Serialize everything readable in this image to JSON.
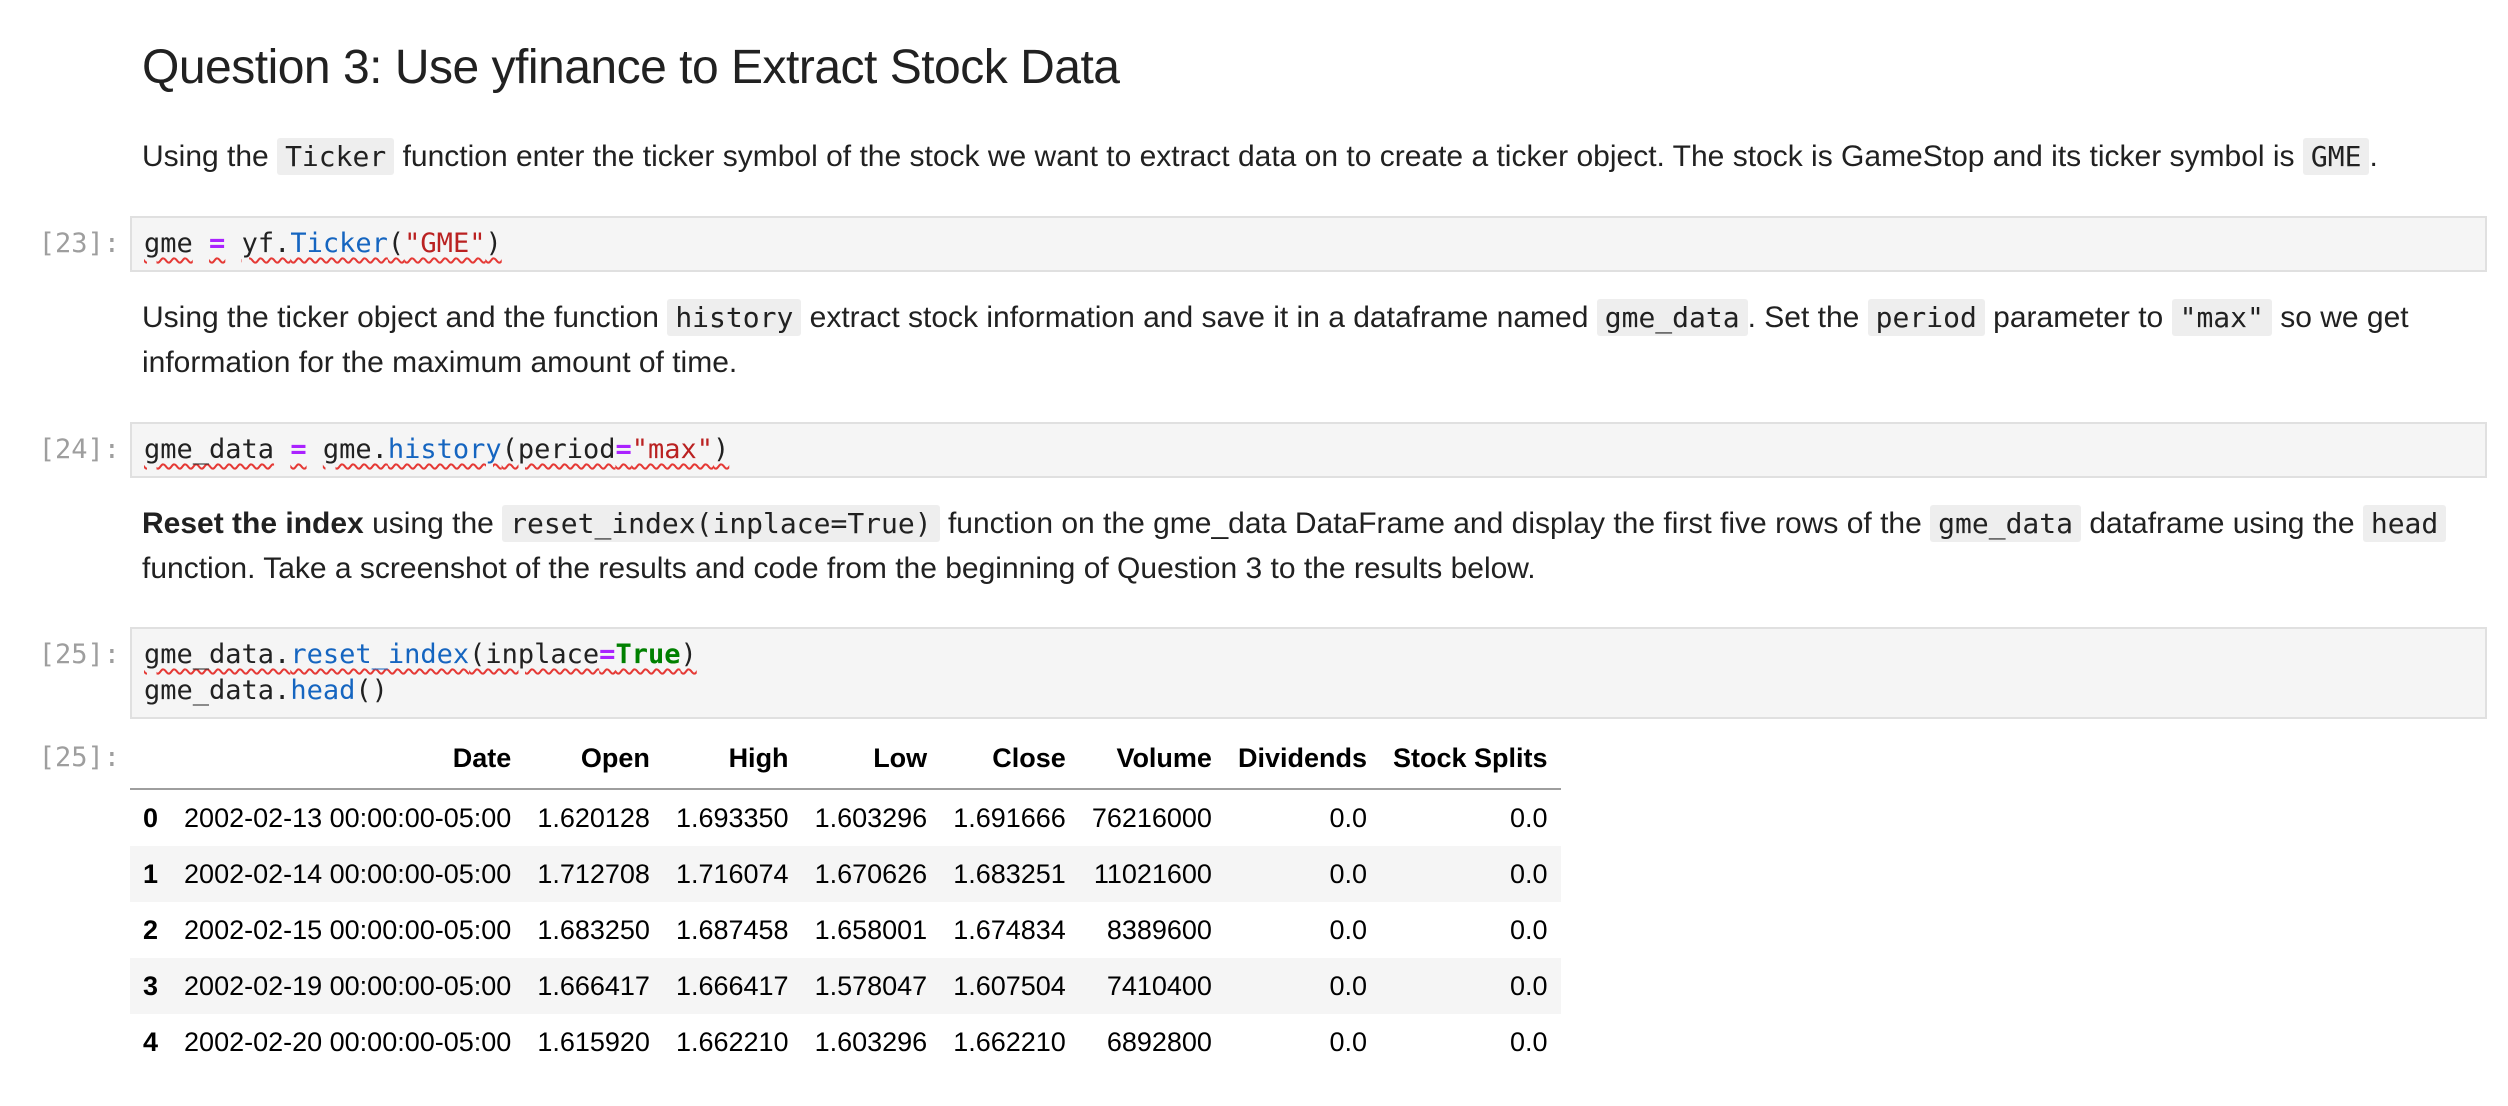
{
  "heading": "Question 3: Use yfinance to Extract Stock Data",
  "p1": {
    "t1": "Using the ",
    "c1": "Ticker",
    "t2": " function enter the ticker symbol of the stock we want to extract data on to create a ticker object. The stock is GameStop and its ticker symbol is ",
    "c2": "GME",
    "t3": "."
  },
  "cell23": {
    "prompt": "[23]:",
    "var": "gme",
    "eq": "=",
    "obj": "yf.",
    "fn": "Ticker",
    "open": "(",
    "str": "\"GME\"",
    "close": ")"
  },
  "p2": {
    "t1": "Using the ticker object and the function ",
    "c1": "history",
    "t2": " extract stock information and save it in a dataframe named ",
    "c2": "gme_data",
    "t3": ". Set the ",
    "c3": "period",
    "t4": " parameter to ",
    "c4": "\"max\"",
    "t5": " so we get information for the maximum amount of time."
  },
  "cell24": {
    "prompt": "[24]:",
    "var": "gme_data",
    "eq": "=",
    "obj": "gme.",
    "fn": "history",
    "arg": "(period",
    "eq2": "=",
    "str": "\"max\"",
    "close": ")"
  },
  "p3": {
    "b1": "Reset the index",
    "t1": " using the ",
    "c1": "reset_index(inplace=True)",
    "t2": " function on the gme_data DataFrame and display the first five rows of the ",
    "c2": "gme_data",
    "t3": " dataframe using the ",
    "c3": "head",
    "t4": " function. Take a screenshot of the results and code from the beginning of Question 3 to the results below."
  },
  "cell25": {
    "prompt": "[25]:",
    "l1_obj": "gme_data.",
    "l1_fn": "reset_index",
    "l1_arg": "(inplace",
    "l1_eq": "=",
    "l1_kw": "True",
    "l1_close": ")",
    "l2_obj": "gme_data.",
    "l2_fn": "head",
    "l2_paren": "()"
  },
  "out25": {
    "prompt": "[25]:",
    "columns": [
      "",
      "Date",
      "Open",
      "High",
      "Low",
      "Close",
      "Volume",
      "Dividends",
      "Stock Splits"
    ],
    "rows": [
      [
        "0",
        "2002-02-13 00:00:00-05:00",
        "1.620128",
        "1.693350",
        "1.603296",
        "1.691666",
        "76216000",
        "0.0",
        "0.0"
      ],
      [
        "1",
        "2002-02-14 00:00:00-05:00",
        "1.712708",
        "1.716074",
        "1.670626",
        "1.683251",
        "11021600",
        "0.0",
        "0.0"
      ],
      [
        "2",
        "2002-02-15 00:00:00-05:00",
        "1.683250",
        "1.687458",
        "1.658001",
        "1.674834",
        "8389600",
        "0.0",
        "0.0"
      ],
      [
        "3",
        "2002-02-19 00:00:00-05:00",
        "1.666417",
        "1.666417",
        "1.578047",
        "1.607504",
        "7410400",
        "0.0",
        "0.0"
      ],
      [
        "4",
        "2002-02-20 00:00:00-05:00",
        "1.615920",
        "1.662210",
        "1.603296",
        "1.662210",
        "6892800",
        "0.0",
        "0.0"
      ]
    ]
  }
}
